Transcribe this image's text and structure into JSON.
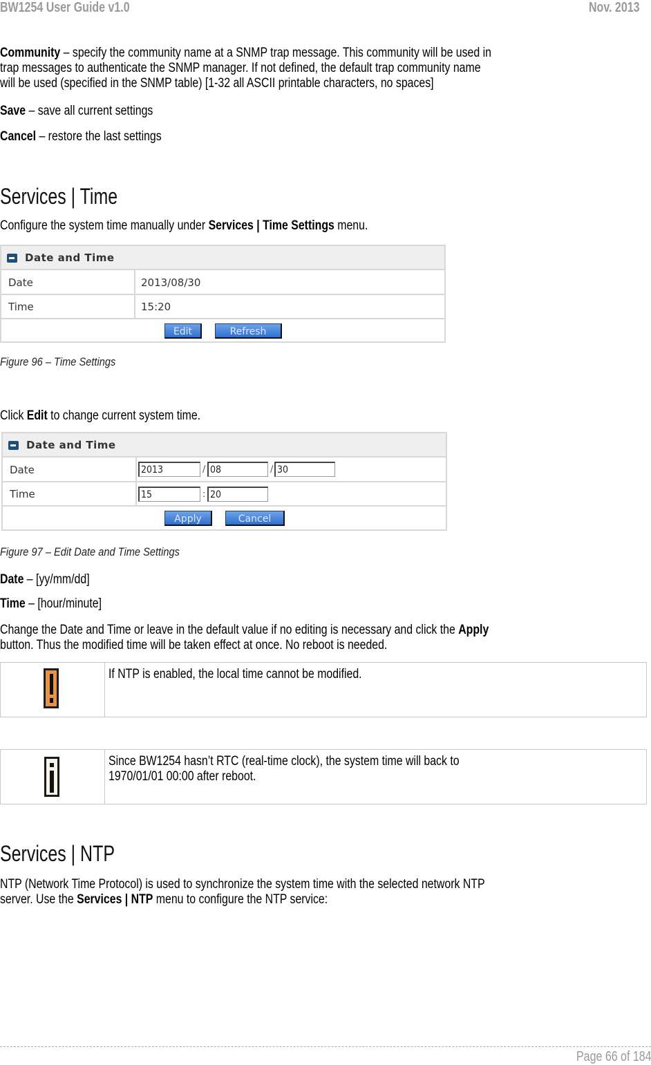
{
  "header": {
    "title": "BW1254 User Guide v1.0",
    "date": "Nov.  2013"
  },
  "intro": {
    "community_term": "Community",
    "community_line1": " – specify the community name at a SNMP trap message. This community will be used in",
    "community_line2": "trap messages to authenticate the SNMP manager. If not defined, the default trap community name",
    "community_line3": "will be used (specified in the SNMP table) [1-32 all ASCII printable characters, no spaces]",
    "save_term": "Save",
    "save_desc": " – save all current settings",
    "cancel_term": "Cancel",
    "cancel_desc": " – restore the last settings"
  },
  "section_time": {
    "heading": "Services | Time",
    "desc_pre": "Configure the system time manually under ",
    "desc_bold": "Services | Time Settings",
    "desc_post": " menu."
  },
  "figure96": {
    "panel_title": "Date and Time",
    "date_label": "Date",
    "date_value": "2013/08/30",
    "time_label": "Time",
    "time_value": "15:20",
    "edit_button": "Edit",
    "refresh_button": "Refresh",
    "caption": "Figure 96 – Time Settings"
  },
  "click_edit": {
    "pre": "Click ",
    "bold": "Edit",
    "post": " to change current system time."
  },
  "figure97": {
    "panel_title": "Date and Time",
    "date_label": "Date",
    "year": "2013",
    "month": "08",
    "day": "30",
    "date_sep": "/",
    "time_label": "Time",
    "hour": "15",
    "minute": "20",
    "time_sep": ":",
    "apply_button": "Apply",
    "cancel_button": "Cancel",
    "caption": "Figure 97 – Edit Date and Time Settings"
  },
  "fields": {
    "date_term": "Date",
    "date_desc": " – [yy/mm/dd]",
    "time_term": "Time",
    "time_desc": " – [hour/minute]",
    "change_line1_pre": "Change the Date and Time or leave in the default value if no editing is necessary and click the ",
    "change_line1_bold": "Apply",
    "change_line2": "button. Thus the modified time will be taken effect at once. No reboot is needed."
  },
  "notes": [
    {
      "icon": "warning-icon",
      "text": "If NTP is enabled, the local time cannot be modified."
    },
    {
      "icon": "info-icon",
      "line1": "Since BW1254 hasn’t RTC (real-time clock), the system time will back to",
      "line2": "1970/01/01 00:00 after reboot."
    }
  ],
  "section_ntp": {
    "heading": "Services | NTP",
    "line1": "NTP (Network Time Protocol) is used to synchronize the system time with the selected network NTP",
    "line2_pre": "server. Use the ",
    "line2_bold": "Services | NTP",
    "line2_post": " menu to configure the NTP service:"
  },
  "footer": {
    "page": "Page 66 of 184"
  }
}
